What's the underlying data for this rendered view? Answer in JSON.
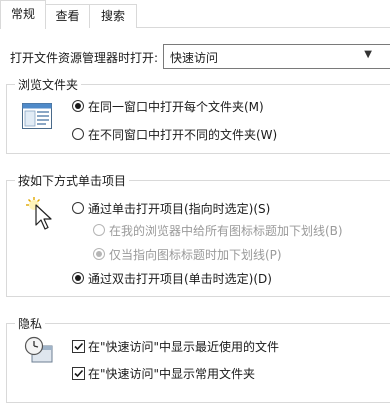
{
  "tabs": [
    {
      "label": "常规",
      "active": true
    },
    {
      "label": "查看",
      "active": false
    },
    {
      "label": "搜索",
      "active": false
    }
  ],
  "open_explorer": {
    "label": "打开文件资源管理器时打开:",
    "selected": "快速访问"
  },
  "browse_folders": {
    "title": "浏览文件夹",
    "icon": "window-icon",
    "options": [
      {
        "label": "在同一窗口中打开每个文件夹(M)",
        "checked": true
      },
      {
        "label": "在不同窗口中打开不同的文件夹(W)",
        "checked": false
      }
    ]
  },
  "click_items": {
    "title": "按如下方式单击项目",
    "icon": "cursor-click-icon",
    "options": [
      {
        "label": "通过单击打开项目(指向时选定)(S)",
        "checked": false
      },
      {
        "label": "在我的浏览器中给所有图标标题加下划线(B)",
        "checked": false,
        "disabled": true
      },
      {
        "label": "仅当指向图标标题时加下划线(P)",
        "checked": true,
        "disabled": true
      },
      {
        "label": "通过双击打开项目(单击时选定)(D)",
        "checked": true
      }
    ]
  },
  "privacy": {
    "title": "隐私",
    "icon": "privacy-clock-icon",
    "options": [
      {
        "label": "在\"快速访问\"中显示最近使用的文件",
        "checked": true
      },
      {
        "label": "在\"快速访问\"中显示常用文件夹",
        "checked": true
      }
    ]
  }
}
